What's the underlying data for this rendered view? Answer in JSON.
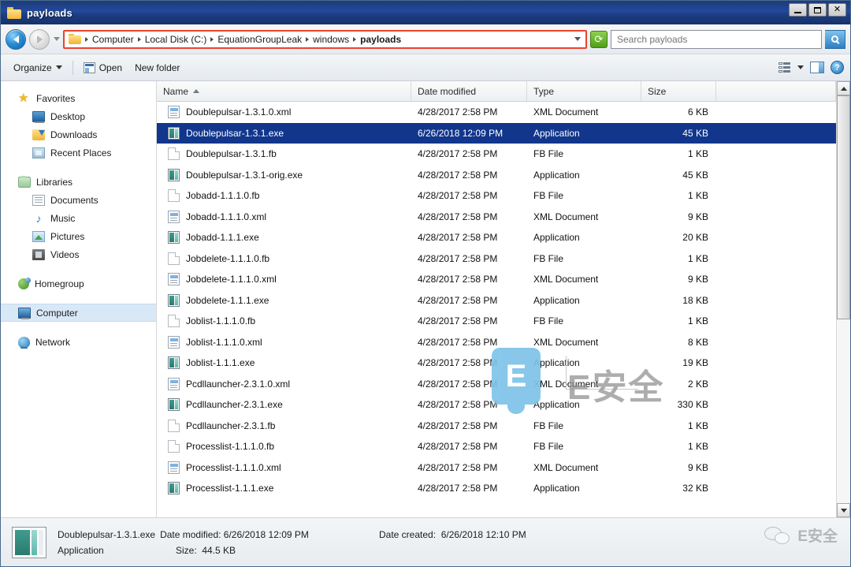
{
  "window": {
    "title": "payloads",
    "folder_icon": "folder-icon",
    "minimize_label": "",
    "maximize_label": "",
    "close_label": "✕"
  },
  "address_bar": {
    "back_icon": "back-arrow-icon",
    "forward_icon": "forward-arrow-icon",
    "history_icon": "chevron-down-icon",
    "folder_icon": "folder-icon",
    "crumbs": [
      "Computer",
      "Local Disk (C:)",
      "EquationGroupLeak",
      "windows",
      "payloads"
    ],
    "dropdown_icon": "chevron-down-icon",
    "refresh_icon": "refresh-icon",
    "refresh_glyph": "⟳",
    "highlight_color": "#e8452c"
  },
  "search": {
    "value": "",
    "placeholder": "Search payloads",
    "icon": "search-icon"
  },
  "toolbar": {
    "organize_label": "Organize",
    "open_label": "Open",
    "open_icon": "open-file-icon",
    "new_folder_label": "New folder",
    "view_icon": "view-list-icon",
    "view_caret_icon": "chevron-down-icon",
    "preview_pane_icon": "preview-pane-icon",
    "help_icon": "help-icon",
    "help_glyph": "?"
  },
  "sidebar": {
    "groups": [
      {
        "header": {
          "label": "Favorites",
          "icon": "star-icon",
          "glyph": "★"
        },
        "items": [
          {
            "label": "Desktop",
            "icon": "desktop-icon"
          },
          {
            "label": "Downloads",
            "icon": "downloads-icon"
          },
          {
            "label": "Recent Places",
            "icon": "recent-places-icon"
          }
        ]
      },
      {
        "header": {
          "label": "Libraries",
          "icon": "libraries-icon"
        },
        "items": [
          {
            "label": "Documents",
            "icon": "documents-icon"
          },
          {
            "label": "Music",
            "icon": "music-icon",
            "glyph": "♪"
          },
          {
            "label": "Pictures",
            "icon": "pictures-icon"
          },
          {
            "label": "Videos",
            "icon": "videos-icon"
          }
        ]
      },
      {
        "header": {
          "label": "Homegroup",
          "icon": "homegroup-icon"
        },
        "items": []
      },
      {
        "header": {
          "label": "Computer",
          "icon": "computer-icon",
          "selected": true
        },
        "items": []
      },
      {
        "header": {
          "label": "Network",
          "icon": "network-icon"
        },
        "items": []
      }
    ]
  },
  "file_list": {
    "columns": [
      {
        "key": "name",
        "label": "Name",
        "sorted": true,
        "sort_icon": "sort-ascending-icon"
      },
      {
        "key": "date",
        "label": "Date modified"
      },
      {
        "key": "type",
        "label": "Type"
      },
      {
        "key": "size",
        "label": "Size"
      }
    ],
    "rows": [
      {
        "name": "Doublepulsar-1.3.1.0.xml",
        "date": "4/28/2017 2:58 PM",
        "type": "XML Document",
        "size": "6 KB",
        "icon": "xml-file-icon",
        "selected": false
      },
      {
        "name": "Doublepulsar-1.3.1.exe",
        "date": "6/26/2018 12:09 PM",
        "type": "Application",
        "size": "45 KB",
        "icon": "exe-file-icon",
        "selected": true
      },
      {
        "name": "Doublepulsar-1.3.1.fb",
        "date": "4/28/2017 2:58 PM",
        "type": "FB File",
        "size": "1 KB",
        "icon": "fb-file-icon",
        "selected": false
      },
      {
        "name": "Doublepulsar-1.3.1-orig.exe",
        "date": "4/28/2017 2:58 PM",
        "type": "Application",
        "size": "45 KB",
        "icon": "exe-file-icon",
        "selected": false
      },
      {
        "name": "Jobadd-1.1.1.0.fb",
        "date": "4/28/2017 2:58 PM",
        "type": "FB File",
        "size": "1 KB",
        "icon": "fb-file-icon",
        "selected": false
      },
      {
        "name": "Jobadd-1.1.1.0.xml",
        "date": "4/28/2017 2:58 PM",
        "type": "XML Document",
        "size": "9 KB",
        "icon": "xml-file-icon",
        "selected": false
      },
      {
        "name": "Jobadd-1.1.1.exe",
        "date": "4/28/2017 2:58 PM",
        "type": "Application",
        "size": "20 KB",
        "icon": "exe-file-icon",
        "selected": false
      },
      {
        "name": "Jobdelete-1.1.1.0.fb",
        "date": "4/28/2017 2:58 PM",
        "type": "FB File",
        "size": "1 KB",
        "icon": "fb-file-icon",
        "selected": false
      },
      {
        "name": "Jobdelete-1.1.1.0.xml",
        "date": "4/28/2017 2:58 PM",
        "type": "XML Document",
        "size": "9 KB",
        "icon": "xml-file-icon",
        "selected": false
      },
      {
        "name": "Jobdelete-1.1.1.exe",
        "date": "4/28/2017 2:58 PM",
        "type": "Application",
        "size": "18 KB",
        "icon": "exe-file-icon",
        "selected": false
      },
      {
        "name": "Joblist-1.1.1.0.fb",
        "date": "4/28/2017 2:58 PM",
        "type": "FB File",
        "size": "1 KB",
        "icon": "fb-file-icon",
        "selected": false
      },
      {
        "name": "Joblist-1.1.1.0.xml",
        "date": "4/28/2017 2:58 PM",
        "type": "XML Document",
        "size": "8 KB",
        "icon": "xml-file-icon",
        "selected": false
      },
      {
        "name": "Joblist-1.1.1.exe",
        "date": "4/28/2017 2:58 PM",
        "type": "Application",
        "size": "19 KB",
        "icon": "exe-file-icon",
        "selected": false
      },
      {
        "name": "Pcdllauncher-2.3.1.0.xml",
        "date": "4/28/2017 2:58 PM",
        "type": "XML Document",
        "size": "2 KB",
        "icon": "xml-file-icon",
        "selected": false
      },
      {
        "name": "Pcdllauncher-2.3.1.exe",
        "date": "4/28/2017 2:58 PM",
        "type": "Application",
        "size": "330 KB",
        "icon": "exe-file-icon",
        "selected": false
      },
      {
        "name": "Pcdllauncher-2.3.1.fb",
        "date": "4/28/2017 2:58 PM",
        "type": "FB File",
        "size": "1 KB",
        "icon": "fb-file-icon",
        "selected": false
      },
      {
        "name": "Processlist-1.1.1.0.fb",
        "date": "4/28/2017 2:58 PM",
        "type": "FB File",
        "size": "1 KB",
        "icon": "fb-file-icon",
        "selected": false
      },
      {
        "name": "Processlist-1.1.1.0.xml",
        "date": "4/28/2017 2:58 PM",
        "type": "XML Document",
        "size": "9 KB",
        "icon": "xml-file-icon",
        "selected": false
      },
      {
        "name": "Processlist-1.1.1.exe",
        "date": "4/28/2017 2:58 PM",
        "type": "Application",
        "size": "32 KB",
        "icon": "exe-file-icon",
        "selected": false
      }
    ],
    "scrollbar": {
      "up_icon": "scroll-up-icon",
      "down_icon": "scroll-down-icon"
    }
  },
  "status_bar": {
    "icon": "exe-file-icon",
    "file_name": "Doublepulsar-1.3.1.exe",
    "date_modified_label": "Date modified:",
    "date_modified_value": "6/26/2018 12:09 PM",
    "date_created_label": "Date created:",
    "date_created_value": "6/26/2018 12:10 PM",
    "type_value": "Application",
    "size_label": "Size:",
    "size_value": "44.5 KB"
  },
  "watermarks": {
    "center_badge": "E",
    "center_text": "E安全",
    "corner_icon": "wechat-icon",
    "corner_text": "E安全"
  }
}
